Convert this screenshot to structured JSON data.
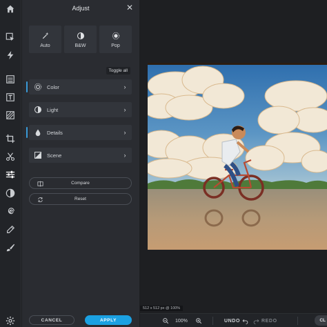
{
  "panel": {
    "title": "Adjust",
    "close_glyph": "✕",
    "presets": [
      {
        "label": "Auto",
        "icon": "magic-wand-icon"
      },
      {
        "label": "B&W",
        "icon": "contrast-icon"
      },
      {
        "label": "Pop",
        "icon": "sun-icon"
      }
    ],
    "toggle_all": "Toggle all",
    "sections": [
      {
        "label": "Color",
        "icon": "color-sun-icon",
        "active": true
      },
      {
        "label": "Light",
        "icon": "light-contrast-icon",
        "active": false
      },
      {
        "label": "Details",
        "icon": "droplet-icon",
        "active": true
      },
      {
        "label": "Scene",
        "icon": "scene-icon",
        "active": false
      }
    ],
    "chevron": "›",
    "compare_label": "Compare",
    "reset_label": "Reset",
    "cancel_label": "CANCEL",
    "apply_label": "APPLY"
  },
  "canvas": {
    "image_info": "512 x 512 px @ 100%"
  },
  "toolbar": {
    "zoom_value": "100%",
    "undo_label": "UNDO",
    "redo_label": "REDO",
    "close_label": "CL"
  },
  "colors": {
    "accent": "#1ba1e2",
    "active_marker": "#3a9bd9",
    "panel_bg": "#2a2c31",
    "rail_bg": "#222428"
  }
}
